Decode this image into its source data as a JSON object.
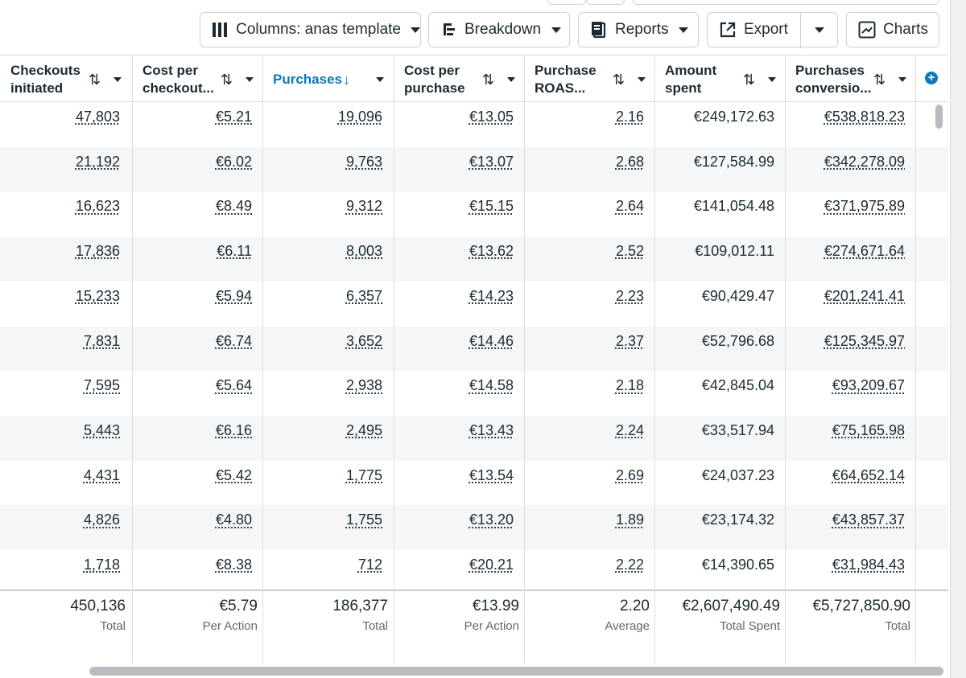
{
  "toolbar": {
    "columns_label": "Columns: anas template",
    "breakdown_label": "Breakdown",
    "reports_label": "Reports",
    "export_label": "Export",
    "charts_label": "Charts"
  },
  "table": {
    "columns": [
      {
        "line1": "Checkouts",
        "line2": "initiated"
      },
      {
        "line1": "Cost per",
        "line2": "checkout..."
      },
      {
        "line1": "Purchases",
        "line2": ""
      },
      {
        "line1": "Cost per",
        "line2": "purchase"
      },
      {
        "line1": "Purchase",
        "line2": "ROAS..."
      },
      {
        "line1": "Amount",
        "line2": "spent"
      },
      {
        "line1": "Purchases",
        "line2": "conversio..."
      }
    ],
    "rows": [
      [
        "47,803",
        "€5.21",
        "19,096",
        "€13.05",
        "2.16",
        "€249,172.63",
        "€538,818.23"
      ],
      [
        "21,192",
        "€6.02",
        "9,763",
        "€13.07",
        "2.68",
        "€127,584.99",
        "€342,278.09"
      ],
      [
        "16,623",
        "€8.49",
        "9,312",
        "€15.15",
        "2.64",
        "€141,054.48",
        "€371,975.89"
      ],
      [
        "17,836",
        "€6.11",
        "8,003",
        "€13.62",
        "2.52",
        "€109,012.11",
        "€274,671.64"
      ],
      [
        "15,233",
        "€5.94",
        "6,357",
        "€14.23",
        "2.23",
        "€90,429.47",
        "€201,241.41"
      ],
      [
        "7,831",
        "€6.74",
        "3,652",
        "€14.46",
        "2.37",
        "€52,796.68",
        "€125,345.97"
      ],
      [
        "7,595",
        "€5.64",
        "2,938",
        "€14.58",
        "2.18",
        "€42,845.04",
        "€93,209.67"
      ],
      [
        "5,443",
        "€6.16",
        "2,495",
        "€13.43",
        "2.24",
        "€33,517.94",
        "€75,165.98"
      ],
      [
        "4,431",
        "€5.42",
        "1,775",
        "€13.54",
        "2.69",
        "€24,037.23",
        "€64,652.14"
      ],
      [
        "4,826",
        "€4.80",
        "1,755",
        "€13.20",
        "1.89",
        "€23,174.32",
        "€43,857.37"
      ],
      [
        "1,718",
        "€8.38",
        "712",
        "€20.21",
        "2.22",
        "€14,390.65",
        "€31,984.43"
      ]
    ],
    "totals": [
      {
        "value": "450,136",
        "label": "Total"
      },
      {
        "value": "€5.79",
        "label": "Per Action"
      },
      {
        "value": "186,377",
        "label": "Total"
      },
      {
        "value": "€13.99",
        "label": "Per Action"
      },
      {
        "value": "2.20",
        "label": "Average"
      },
      {
        "value": "€2,607,490.49",
        "label": "Total Spent"
      },
      {
        "value": "€5,727,850.90",
        "label": "Total"
      }
    ]
  },
  "colors": {
    "accent": "#0a78be",
    "text": "#1c2b33",
    "alt_row": "#f5f6f7"
  }
}
